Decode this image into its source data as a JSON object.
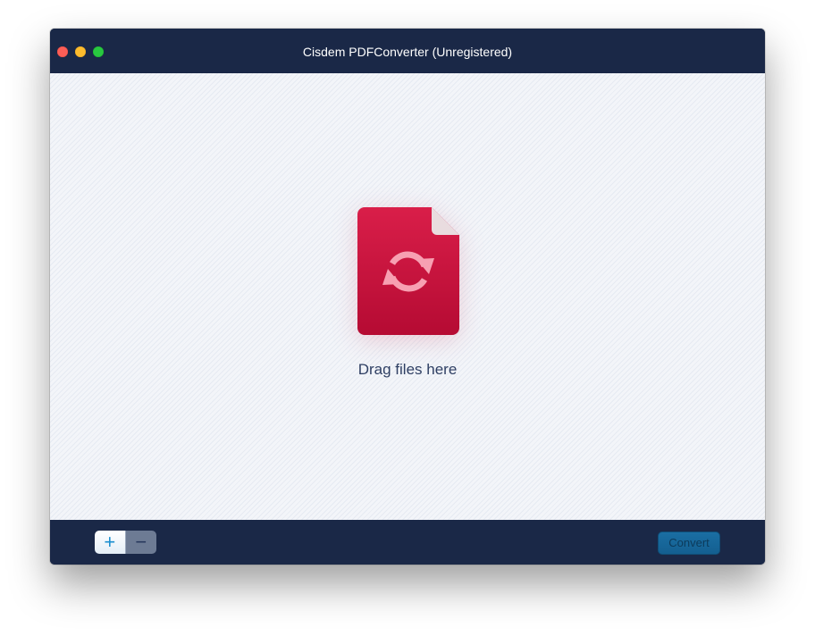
{
  "window": {
    "title": "Cisdem PDFConverter (Unregistered)",
    "controls": [
      "close",
      "minimize",
      "zoom"
    ]
  },
  "dropzone": {
    "icon": "pdf-convert-file-icon",
    "label": "Drag files here"
  },
  "toolbar": {
    "add_label": "+",
    "remove_label": "−",
    "convert_label": "Convert"
  },
  "colors": {
    "titlebar_bg": "#1a2847",
    "content_bg": "#f3f5f9",
    "file_icon": "#c8143c",
    "accent": "#1b8fd0",
    "convert_bg": "#1a6ea3"
  }
}
